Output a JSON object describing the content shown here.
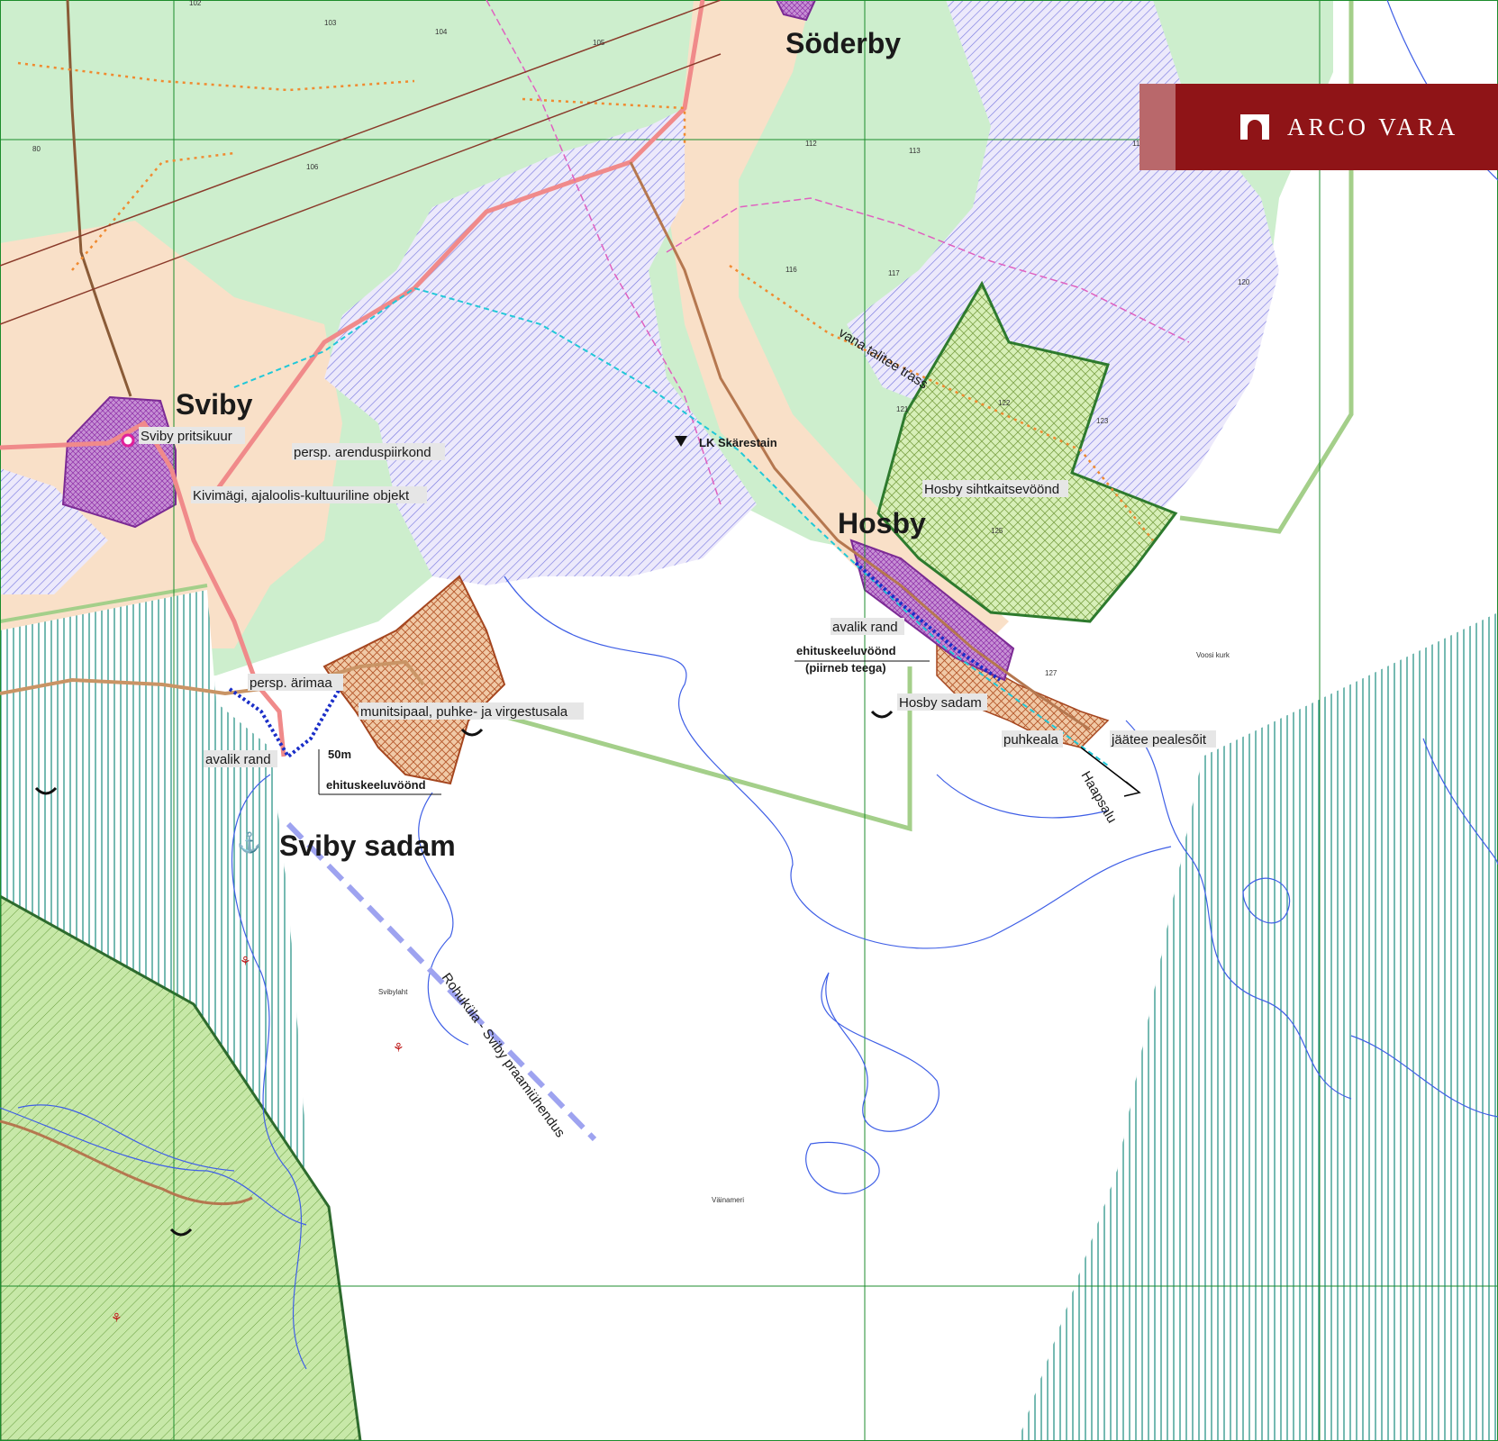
{
  "logo": {
    "name": "ARCO VARA",
    "color": "#8f1417",
    "icon": "house-arch-icon"
  },
  "places": {
    "soderby": "Söderby",
    "sviby": "Sviby",
    "hosby": "Hosby",
    "sviby_sadam": "Sviby sadam"
  },
  "labels": {
    "sviby_pritsikuur": "Sviby pritsikuur",
    "persp_arenduspiirkond": "persp. arenduspiirkond",
    "kivimagi": "Kivimägi, ajaloolis-kultuuriline objekt",
    "lk_skarestain": "LK Skärestain",
    "vana_talitee_trass": "vana talitee trass",
    "hosby_sihtkaitsevoond": "Hosby sihtkaitsevöönd",
    "avalik_rand_hosby": "avalik rand",
    "ehituskeeluvoond_hosby": "ehituskeeluvöönd",
    "piirneb_teega": "(piirneb teega)",
    "hosby_sadam": "Hosby sadam",
    "puhkeala": "puhkeala",
    "jaatee_pealesoit": "jäätee pealesõit",
    "haapsalu": "Haapsalu",
    "persp_arimaa": "persp. ärimaa",
    "munitsipaal": "munitsipaal, puhke- ja virgestusala",
    "avalik_rand_sviby": "avalik rand",
    "fifty_m": "50m",
    "ehituskeeluvoond_sviby": "ehituskeeluvöönd",
    "ferry_route": "Rohuküla - Sviby praamiühendus",
    "voosi_kurk": "Voosi kurk",
    "vainameri": "Väinameri",
    "svibylaht": "Svibylaht"
  },
  "parcel_numbers": [
    "102",
    "103",
    "104",
    "105",
    "106",
    "112",
    "113",
    "115",
    "116",
    "117",
    "120",
    "121",
    "122",
    "123",
    "125",
    "127",
    "80"
  ],
  "colors": {
    "forest": "#cdeecd",
    "residential": "#f9e0c8",
    "conservation_hatch": "#7b7be0",
    "sea_hatch": "#1c8c80",
    "planned_business": "#a5461f",
    "village_core": "#9b3fb4",
    "road": "#f08a8a",
    "ferry_line": "#9ea3f0",
    "protected_zone": "#2d7a2d",
    "zone_outline": "#7fb56b"
  }
}
